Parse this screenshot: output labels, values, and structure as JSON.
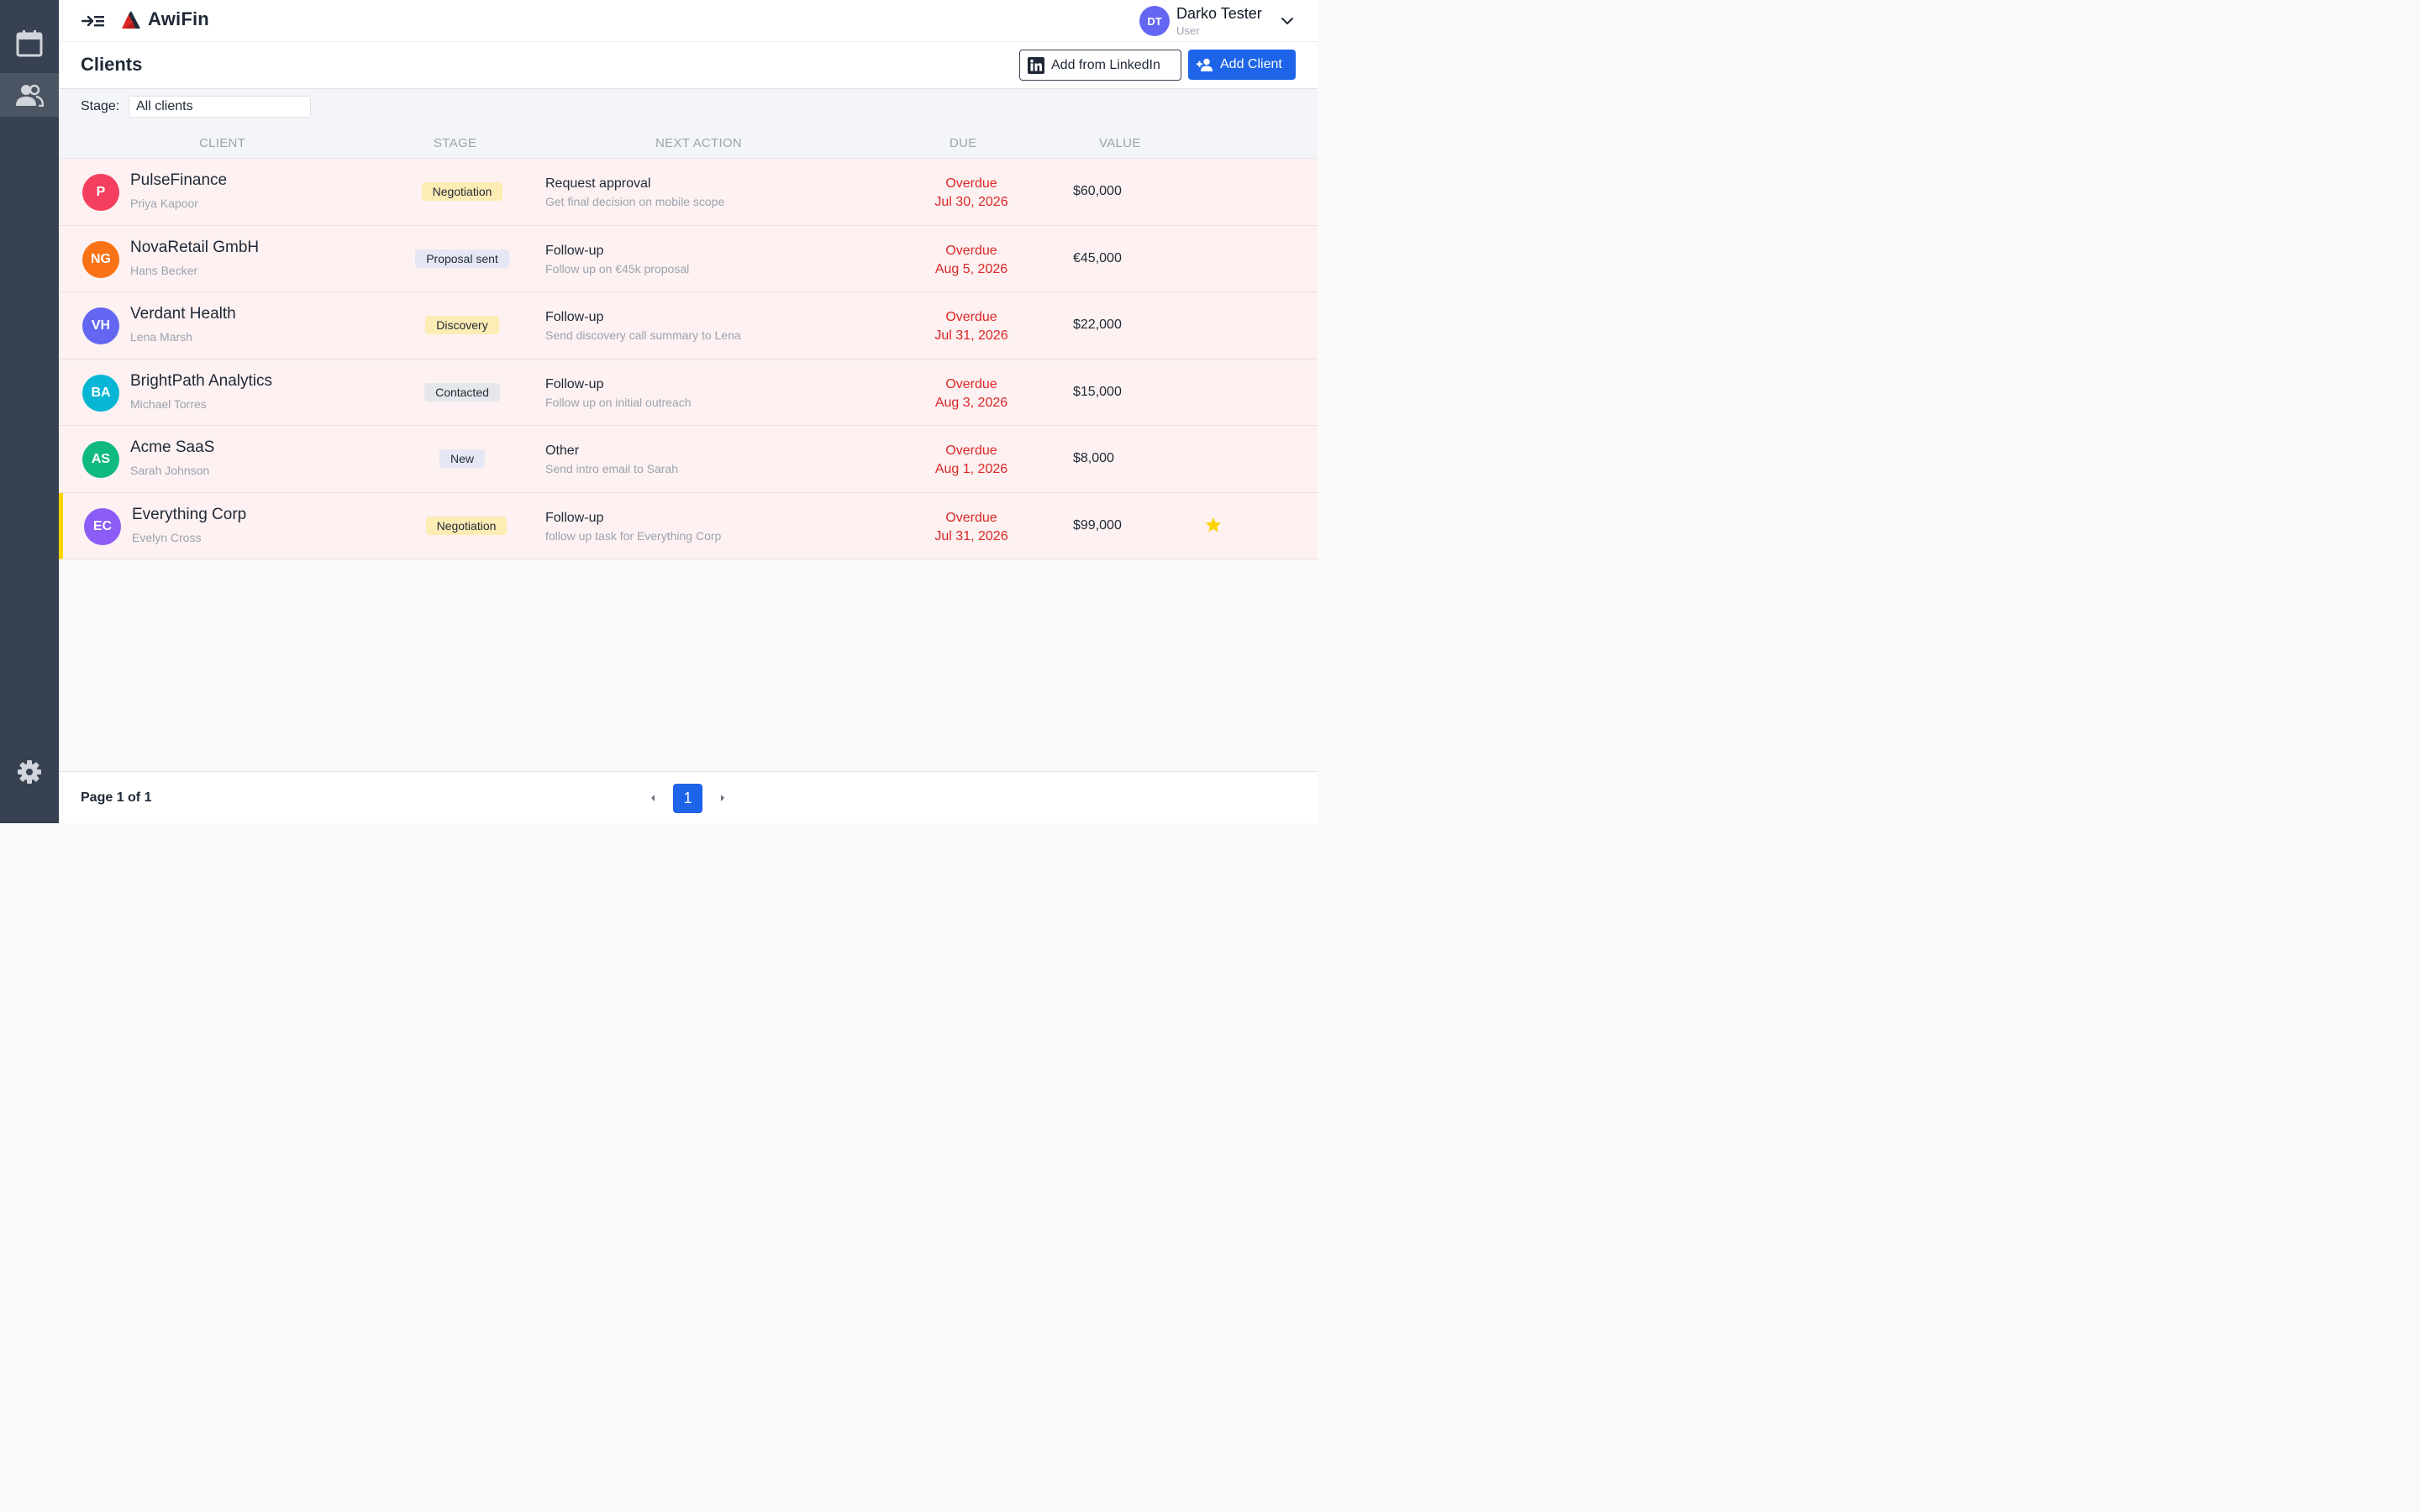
{
  "app": {
    "name": "AwiFin"
  },
  "user": {
    "initials": "DT",
    "name": "Darko Tester",
    "role": "User",
    "avatar_color": "#6366f1"
  },
  "page": {
    "title": "Clients"
  },
  "actions": {
    "linkedin_label": "Add from LinkedIn",
    "add_label": "Add Client"
  },
  "filter": {
    "label": "Stage:",
    "value": "All clients"
  },
  "table": {
    "headers": {
      "client": "CLIENT",
      "stage": "STAGE",
      "next_action": "NEXT ACTION",
      "due": "DUE",
      "value": "VALUE"
    },
    "rows": [
      {
        "initials": "P",
        "avatar_color": "#f43f5e",
        "name": "PulseFinance",
        "contact": "Priya Kapoor",
        "stage": "Negotiation",
        "stage_color": "#fdecb3",
        "action": "Request approval",
        "action_note": "Get final decision on mobile scope",
        "due_status": "Overdue",
        "due_date": "Jul 30, 2026",
        "value": "$60,000",
        "starred": false
      },
      {
        "initials": "NG",
        "avatar_color": "#f97316",
        "name": "NovaRetail GmbH",
        "contact": "Hans Becker",
        "stage": "Proposal sent",
        "stage_color": "#e5e7f5",
        "action": "Follow-up",
        "action_note": "Follow up on €45k proposal",
        "due_status": "Overdue",
        "due_date": "Aug 5, 2026",
        "value": "€45,000",
        "starred": false
      },
      {
        "initials": "VH",
        "avatar_color": "#6366f1",
        "name": "Verdant Health",
        "contact": "Lena Marsh",
        "stage": "Discovery",
        "stage_color": "#fdecb3",
        "action": "Follow-up",
        "action_note": "Send discovery call summary to Lena",
        "due_status": "Overdue",
        "due_date": "Jul 31, 2026",
        "value": "$22,000",
        "starred": false
      },
      {
        "initials": "BA",
        "avatar_color": "#06b6d4",
        "name": "BrightPath Analytics",
        "contact": "Michael Torres",
        "stage": "Contacted",
        "stage_color": "#e5e7eb",
        "action": "Follow-up",
        "action_note": "Follow up on initial outreach",
        "due_status": "Overdue",
        "due_date": "Aug 3, 2026",
        "value": "$15,000",
        "starred": false
      },
      {
        "initials": "AS",
        "avatar_color": "#10b981",
        "name": "Acme SaaS",
        "contact": "Sarah Johnson",
        "stage": "New",
        "stage_color": "#e5e7f5",
        "action": "Other",
        "action_note": "Send intro email to Sarah",
        "due_status": "Overdue",
        "due_date": "Aug 1, 2026",
        "value": "$8,000",
        "starred": false
      },
      {
        "initials": "EC",
        "avatar_color": "#8b5cf6",
        "name": "Everything Corp",
        "contact": "Evelyn Cross",
        "stage": "Negotiation",
        "stage_color": "#fdecb3",
        "action": "Follow-up",
        "action_note": "follow up task for Everything Corp",
        "due_status": "Overdue",
        "due_date": "Jul 31, 2026",
        "value": "$99,000",
        "starred": true
      }
    ]
  },
  "pagination": {
    "info": "Page 1 of 1",
    "current": "1"
  },
  "icons": {
    "sidebar": [
      "calendar-icon",
      "users-icon",
      "gear-icon"
    ],
    "topbar": [
      "collapse-menu-icon",
      "logo-icon",
      "chevron-down-icon"
    ],
    "buttons": [
      "linkedin-icon",
      "add-user-icon"
    ],
    "row": [
      "star-icon"
    ],
    "pagination": [
      "caret-left-icon",
      "caret-right-icon"
    ]
  },
  "colors": {
    "accent": "#1d64e8",
    "overdue": "#dc2626",
    "star": "#fcd400",
    "sidebar": "#374151",
    "row_overdue_bg": "#fdf1f1"
  }
}
